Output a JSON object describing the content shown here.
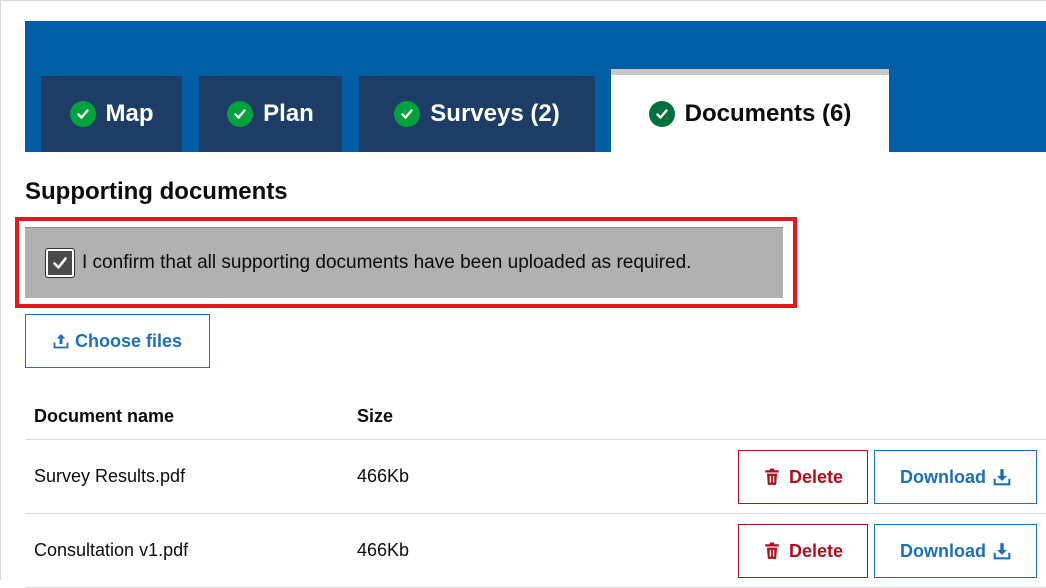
{
  "tabs": [
    {
      "label": "Map",
      "status": "complete"
    },
    {
      "label": "Plan",
      "status": "complete"
    },
    {
      "label": "Surveys (2)",
      "status": "complete"
    },
    {
      "label": "Documents (6)",
      "status": "complete",
      "active": true
    }
  ],
  "section": {
    "title": "Supporting documents"
  },
  "confirm": {
    "checked": true,
    "text": "I confirm that all supporting documents have been uploaded as required."
  },
  "upload": {
    "label": "Choose files",
    "icon": "upload-icon"
  },
  "table": {
    "headers": {
      "name": "Document name",
      "size": "Size"
    },
    "rows": [
      {
        "name": "Survey Results.pdf",
        "size": "466Kb",
        "delete_label": "Delete",
        "download_label": "Download"
      },
      {
        "name": "Consultation v1.pdf",
        "size": "466Kb",
        "delete_label": "Delete",
        "download_label": "Download"
      }
    ]
  },
  "colors": {
    "header_blue": "#005ea5",
    "tab_dark": "#1d3d66",
    "tick_green": "#00a33b",
    "highlight_red": "#e5161d",
    "link_blue": "#1d70b8",
    "delete_red": "#b10e1e"
  }
}
